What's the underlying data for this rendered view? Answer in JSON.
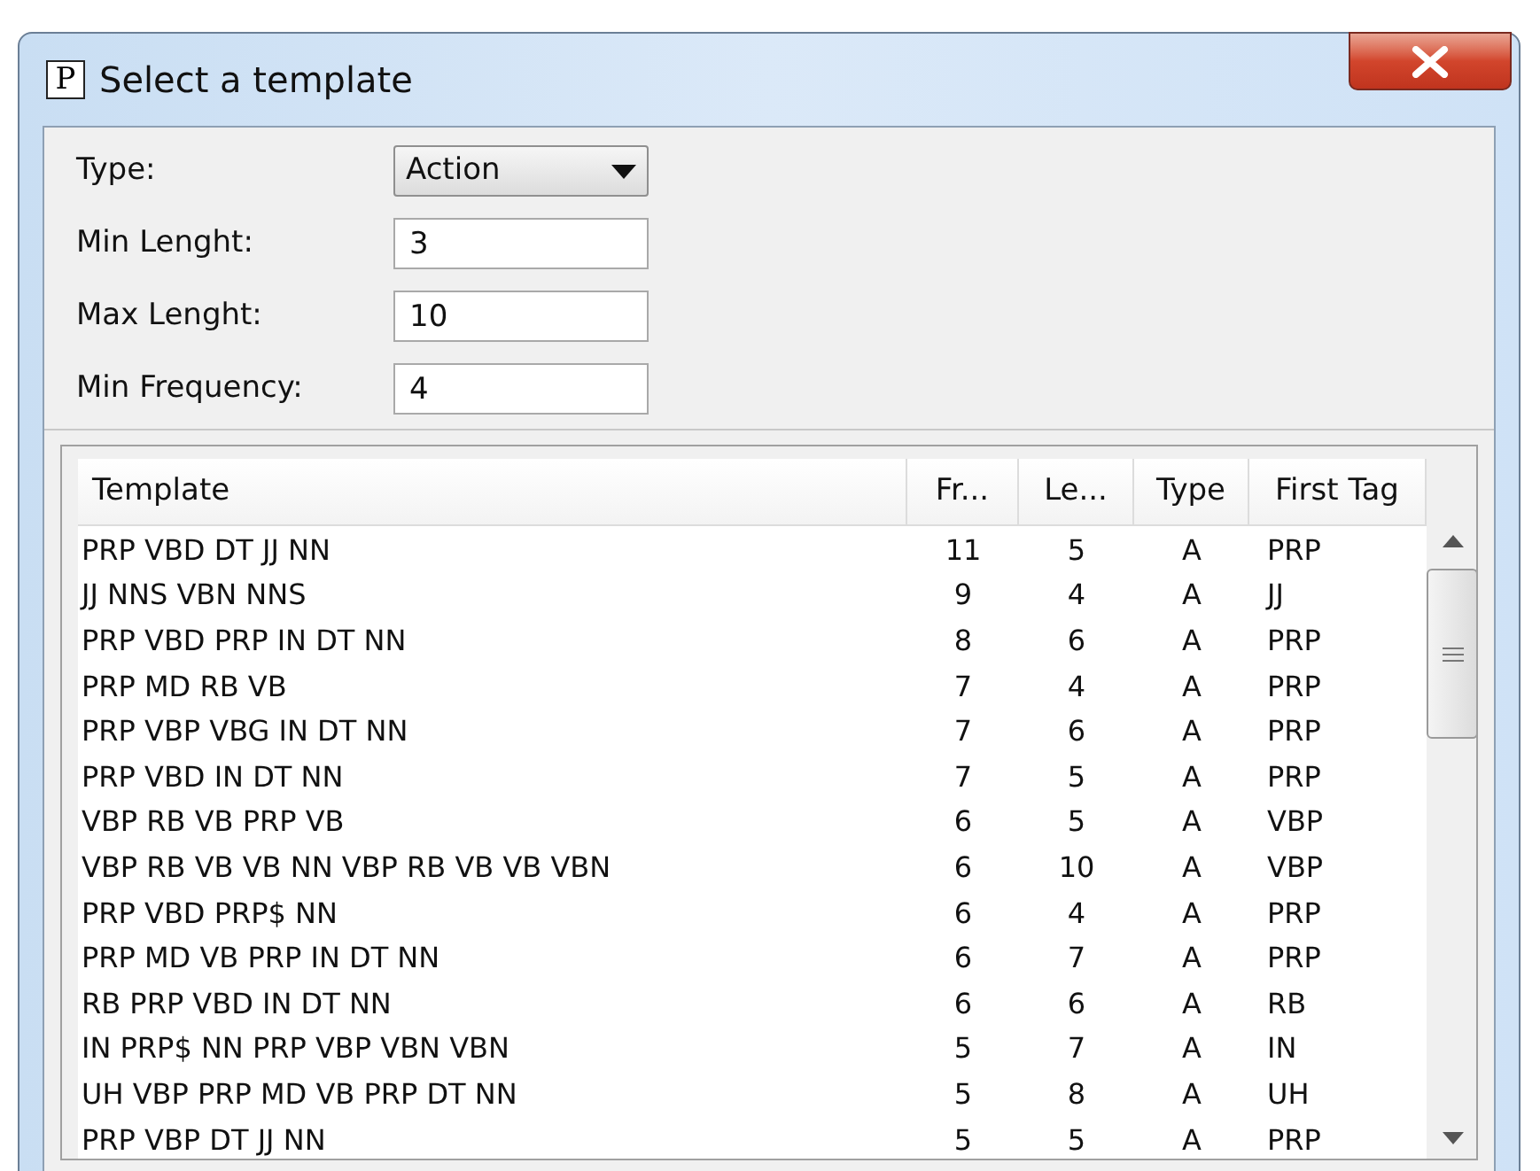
{
  "window": {
    "title": "Select a template",
    "icon_letter": "P"
  },
  "form": [
    {
      "kind": "select",
      "label": "Type:",
      "value": "Action"
    },
    {
      "kind": "text",
      "label": "Min Lenght:",
      "value": "3"
    },
    {
      "kind": "text",
      "label": "Max Lenght:",
      "value": "10"
    },
    {
      "kind": "text",
      "label": "Min Frequency:",
      "value": "4"
    }
  ],
  "table": {
    "columns": [
      "Template",
      "Fr...",
      "Le...",
      "Type",
      "First Tag"
    ],
    "rows": [
      [
        "PRP VBD DT JJ NN",
        "11",
        "5",
        "A",
        "PRP"
      ],
      [
        "JJ NNS VBN NNS",
        "9",
        "4",
        "A",
        "JJ"
      ],
      [
        "PRP VBD PRP IN DT NN",
        "8",
        "6",
        "A",
        "PRP"
      ],
      [
        "PRP MD RB VB",
        "7",
        "4",
        "A",
        "PRP"
      ],
      [
        "PRP VBP VBG IN DT NN",
        "7",
        "6",
        "A",
        "PRP"
      ],
      [
        "PRP VBD IN DT NN",
        "7",
        "5",
        "A",
        "PRP"
      ],
      [
        "VBP RB VB PRP VB",
        "6",
        "5",
        "A",
        "VBP"
      ],
      [
        "VBP RB VB VB NN VBP RB VB VB VBN",
        "6",
        "10",
        "A",
        "VBP"
      ],
      [
        "PRP VBD PRP$ NN",
        "6",
        "4",
        "A",
        "PRP"
      ],
      [
        "PRP MD VB PRP IN DT NN",
        "6",
        "7",
        "A",
        "PRP"
      ],
      [
        "RB PRP VBD IN DT NN",
        "6",
        "6",
        "A",
        "RB"
      ],
      [
        "IN PRP$ NN PRP VBP VBN VBN",
        "5",
        "7",
        "A",
        "IN"
      ],
      [
        "UH VBP PRP MD VB PRP DT NN",
        "5",
        "8",
        "A",
        "UH"
      ],
      [
        "PRP VBP DT JJ NN",
        "5",
        "5",
        "A",
        "PRP"
      ]
    ]
  }
}
